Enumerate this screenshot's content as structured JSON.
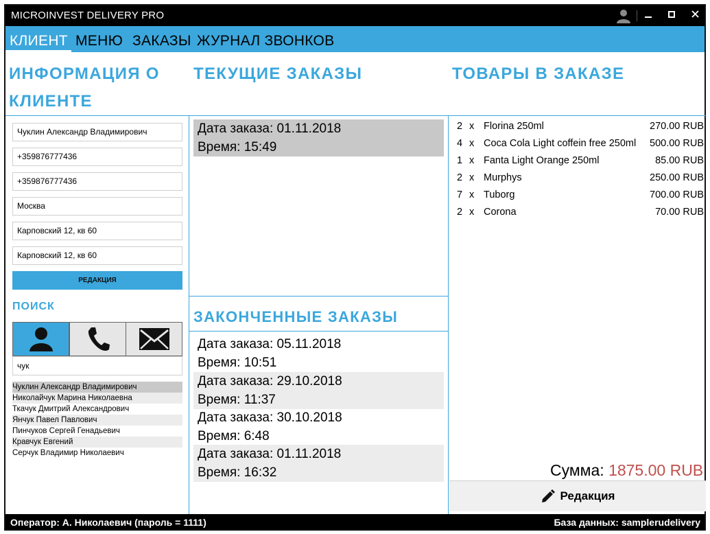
{
  "window": {
    "title": "MICROINVEST DELIVERY PRO",
    "controls": {
      "minimize": "▁",
      "maximize": "□",
      "close": "✕"
    }
  },
  "menu": {
    "items": [
      "КЛИЕНТ",
      "МЕНЮ",
      "ЗАКАЗЫ",
      "ЖУРНАЛ ЗВОНКОВ"
    ],
    "active": "КЛИЕНТ"
  },
  "client": {
    "heading_line1": "ИНФОРМАЦИЯ О",
    "heading_line2": "КЛИЕНТЕ",
    "name": "Чуклин Александр Владимирович",
    "phone1": "+359876777436",
    "phone2": "+359876777436",
    "city": "Москва",
    "address1": "Карповский 12, кв 60",
    "address2": "Карповский 12, кв 60",
    "edit_label": "РЕДАКЦИЯ"
  },
  "search": {
    "title": "ПОИСК",
    "modes": [
      "person-icon",
      "phone-icon",
      "envelope-icon"
    ],
    "query": "чук",
    "results": [
      "Чуклин Александр Владимирович",
      "Николайчук Марина Николаевна",
      "Ткачук Дмитрий Александрович",
      "Янчук Павел Павлович",
      "Пинчуков Сергей Генадьевич",
      "Кравчук Евгений",
      "Серчук Владимир Николаевич"
    ]
  },
  "current_orders": {
    "heading": "ТЕКУЩИЕ ЗАКАЗЫ",
    "items": [
      {
        "date": "Дата заказа: 01.11.2018",
        "time": "Время: 15:49"
      }
    ]
  },
  "finished_orders": {
    "heading": "ЗАКОНЧЕННЫЕ ЗАКАЗЫ",
    "items": [
      {
        "date": "Дата заказа: 05.11.2018",
        "time": "Время: 10:51"
      },
      {
        "date": "Дата заказа: 29.10.2018",
        "time": "Время: 11:37"
      },
      {
        "date": "Дата заказа: 30.10.2018",
        "time": "Время: 6:48"
      },
      {
        "date": "Дата заказа: 01.11.2018",
        "time": "Время: 16:32"
      }
    ]
  },
  "goods": {
    "heading": "ТОВАРЫ В ЗАКАЗЕ",
    "items": [
      {
        "qty": "2",
        "x": "x",
        "name": "Florina 250ml",
        "price": "270.00 RUB"
      },
      {
        "qty": "4",
        "x": "x",
        "name": "Coca Cola Light coffein free 250ml",
        "price": "500.00 RUB"
      },
      {
        "qty": "1",
        "x": "x",
        "name": "Fanta Light Orange 250ml",
        "price": "85.00 RUB"
      },
      {
        "qty": "2",
        "x": "x",
        "name": "Murphys",
        "price": "250.00 RUB"
      },
      {
        "qty": "7",
        "x": "x",
        "name": "Tuborg",
        "price": "700.00 RUB"
      },
      {
        "qty": "2",
        "x": "x",
        "name": "Corona",
        "price": "70.00 RUB"
      }
    ],
    "total_label": "Сумма:",
    "total_value": "1875.00 RUB",
    "edit_label": "Редакция"
  },
  "status": {
    "operator": "Оператор: А. Николаевич (пароль = 1111)",
    "database": "База данных: samplerudelivery"
  },
  "colors": {
    "accent": "#3ba7dd",
    "total": "#c0504d"
  }
}
